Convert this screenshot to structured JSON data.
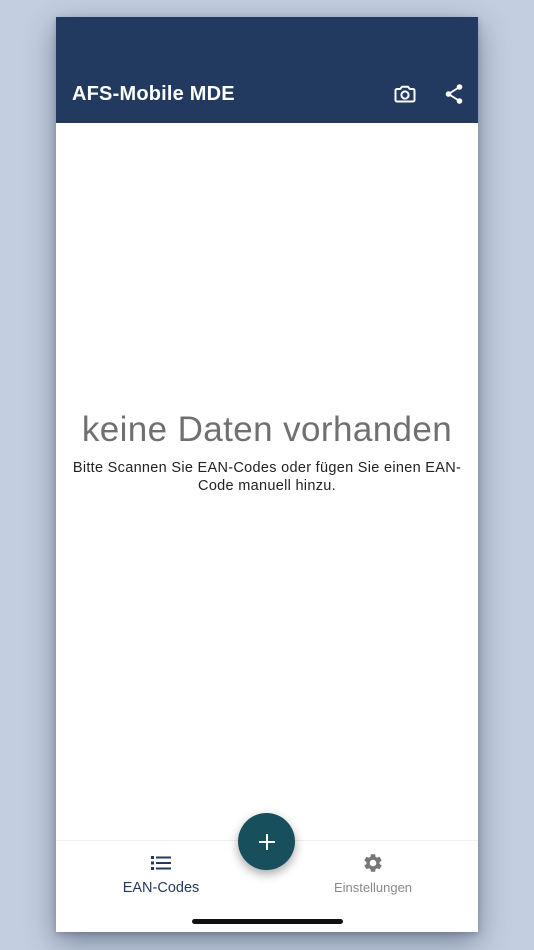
{
  "appbar": {
    "title": "AFS-Mobile MDE",
    "background": "#233a60",
    "actions": [
      {
        "icon": "camera-icon"
      },
      {
        "icon": "share-icon"
      }
    ]
  },
  "empty_state": {
    "title": "keine Daten vorhanden",
    "subtitle": "Bitte Scannen Sie EAN-Codes oder fügen Sie einen EAN-Code manuell hinzu."
  },
  "fab": {
    "icon": "plus-icon",
    "color": "#174f5c"
  },
  "bottom_nav": {
    "items": [
      {
        "label": "EAN-Codes",
        "icon": "list-icon",
        "active": true
      },
      {
        "label": "Einstellungen",
        "icon": "gear-icon",
        "active": false
      }
    ]
  },
  "colors": {
    "accent": "#233a60",
    "inactive": "#8a8a8a"
  }
}
